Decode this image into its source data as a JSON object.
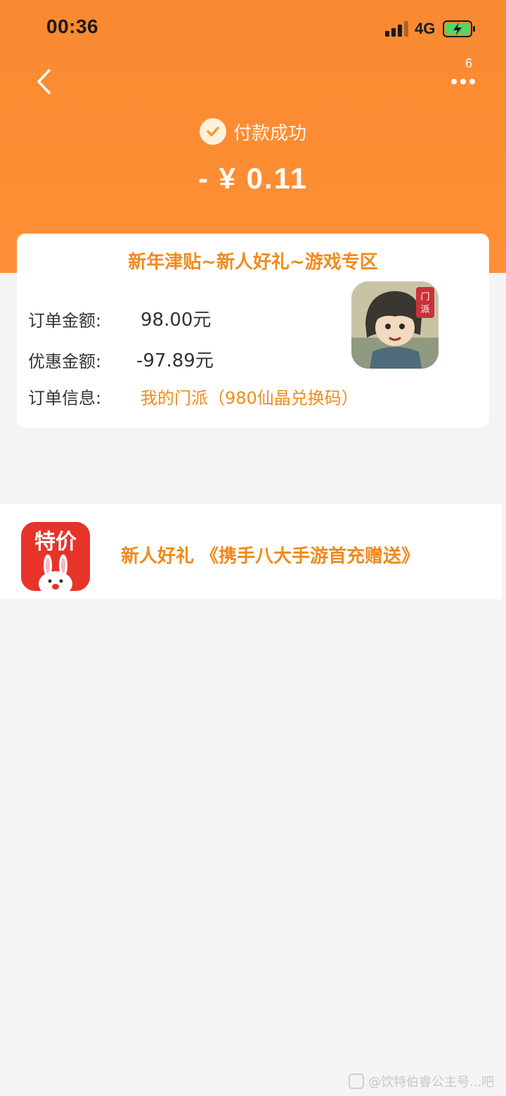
{
  "status_bar": {
    "time": "00:36",
    "network": "4G",
    "signal_icon": "signal-bars-icon",
    "battery_icon": "battery-charging-icon"
  },
  "nav": {
    "back_icon": "chevron-left-icon",
    "more_icon": "more-dots-icon",
    "more_count": "6"
  },
  "payment": {
    "status_icon": "check-circle-icon",
    "status_text": "付款成功",
    "amount": "- ¥ 0.11"
  },
  "order_card": {
    "title": "新年津贴~新人好礼~游戏专区",
    "rows": [
      {
        "label": "订单金额:",
        "value": "98.00元"
      },
      {
        "label": "优惠金额:",
        "value": "-97.89元"
      },
      {
        "label": "订单信息:",
        "value": "我的门派（980仙晶兑换码）"
      }
    ],
    "game_icon_text": "门派"
  },
  "promo": {
    "app_icon_text": "特价",
    "text": "新人好礼 《携手八大手游首充赠送》"
  },
  "watermark": {
    "text": "@饮特伯睿公主号...吧"
  },
  "colors": {
    "header": "#fd8d33",
    "accent": "#f08a1c",
    "background": "#f4f4f4",
    "promo_icon": "#e8332a"
  }
}
